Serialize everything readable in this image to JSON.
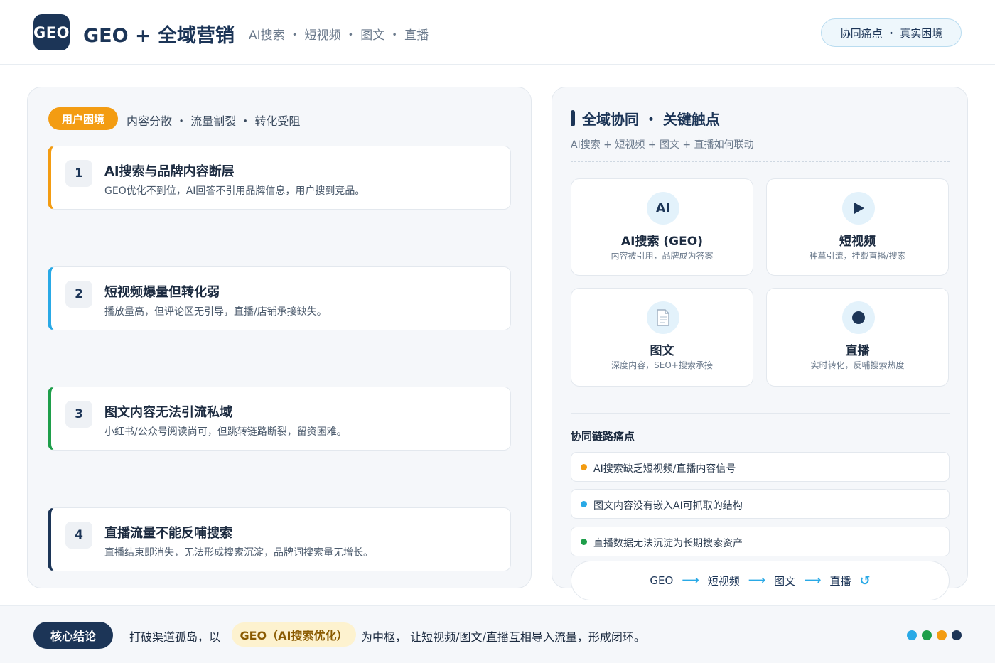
{
  "header": {
    "logo_text": "GEO",
    "title": "GEO + 全域营销",
    "channels": "AI搜索 ・ 短视频 ・ 图文 ・ 直播",
    "pill": "协同痛点 ・ 真实困境"
  },
  "left": {
    "tag": "用户困境",
    "subtitle": "内容分散 ・ 流量割裂 ・ 转化受阻",
    "cards": [
      {
        "num": "1",
        "title": "AI搜索与品牌内容断层",
        "desc": "GEO优化不到位，AI回答不引用品牌信息，用户搜到竞品。",
        "accent": "#f39c12"
      },
      {
        "num": "2",
        "title": "短视频爆量但转化弱",
        "desc": "播放量高，但评论区无引导，直播/店铺承接缺失。",
        "accent": "#29a9e6"
      },
      {
        "num": "3",
        "title": "图文内容无法引流私域",
        "desc": "小红书/公众号阅读尚可，但跳转链路断裂，留资困难。",
        "accent": "#1e9e4a"
      },
      {
        "num": "4",
        "title": "直播流量不能反哺搜索",
        "desc": "直播结束即消失，无法形成搜索沉淀，品牌词搜索量无增长。",
        "accent": "#1c3557"
      }
    ]
  },
  "right": {
    "title": "全域协同 ・ 关键触点",
    "subtitle": "AI搜索 + 短视频 + 图文 + 直播如何联动",
    "channels": [
      {
        "icon_name": "ai-icon",
        "icon_text": "AI",
        "name": "AI搜索 (GEO)",
        "desc": "内容被引用，品牌成为答案"
      },
      {
        "icon_name": "play-icon",
        "icon_text": "▶",
        "name": "短视频",
        "desc": "种草引流，挂载直播/搜索"
      },
      {
        "icon_name": "document-icon",
        "icon_text": "📄",
        "name": "图文",
        "desc": "深度内容，SEO+搜索承接"
      },
      {
        "icon_name": "live-dot-icon",
        "icon_text": "●",
        "name": "直播",
        "desc": "实时转化，反哺搜索热度"
      }
    ],
    "sync_title": "协同链路痛点",
    "sync_items": [
      {
        "text": "AI搜索缺乏短视频/直播内容信号",
        "color": "#f39c12"
      },
      {
        "text": "图文内容没有嵌入AI可抓取的结构",
        "color": "#29a9e6"
      },
      {
        "text": "直播数据无法沉淀为长期搜索资产",
        "color": "#1e9e4a"
      }
    ],
    "flow": {
      "step1": "GEO",
      "step2": "短视频",
      "step3": "图文",
      "step4": "直播",
      "arrow": "⟶",
      "cycle": "↺"
    }
  },
  "footer": {
    "badge": "核心结论",
    "pre": "打破渠道孤岛，以",
    "highlight": "GEO（AI搜索优化）",
    "post": "为中枢，  让短视频/图文/直播互相导入流量，形成闭环。",
    "dots": [
      "#29a9e6",
      "#1e9e4a",
      "#f39c12",
      "#1c3557"
    ]
  }
}
